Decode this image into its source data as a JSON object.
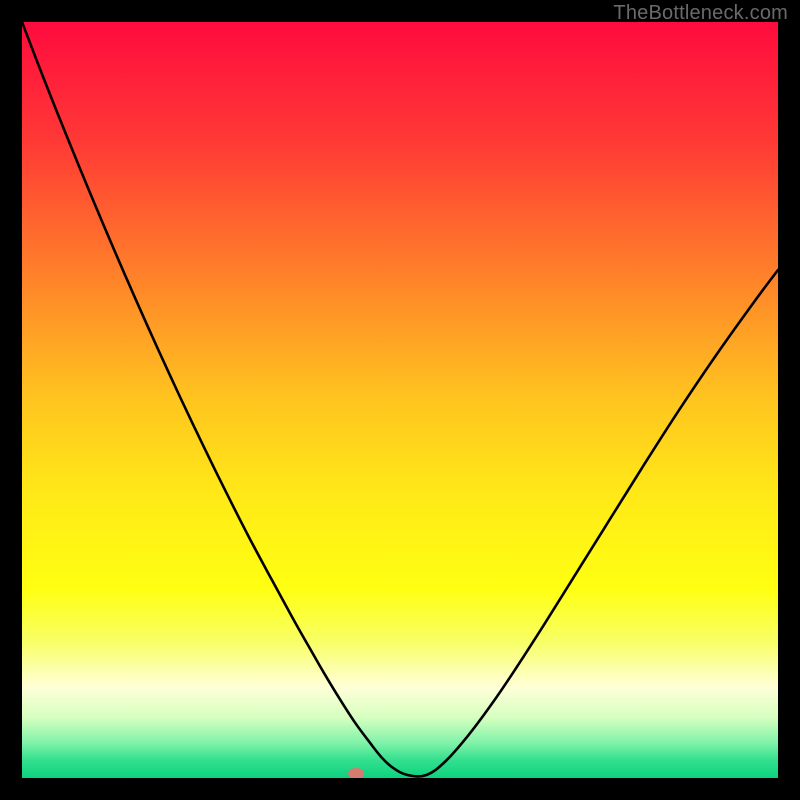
{
  "watermark": "TheBottleneck.com",
  "chart_data": {
    "type": "line",
    "title": "",
    "xlabel": "",
    "ylabel": "",
    "xlim": [
      0,
      100
    ],
    "ylim": [
      0,
      100
    ],
    "grid": false,
    "legend": false,
    "gradient_stops": [
      {
        "offset": 0.0,
        "color": "#ff0b3e"
      },
      {
        "offset": 0.16,
        "color": "#ff3a35"
      },
      {
        "offset": 0.33,
        "color": "#ff7f2a"
      },
      {
        "offset": 0.5,
        "color": "#ffc51f"
      },
      {
        "offset": 0.63,
        "color": "#ffea17"
      },
      {
        "offset": 0.75,
        "color": "#ffff12"
      },
      {
        "offset": 0.82,
        "color": "#f8ff66"
      },
      {
        "offset": 0.88,
        "color": "#ffffd8"
      },
      {
        "offset": 0.92,
        "color": "#d6ffc0"
      },
      {
        "offset": 0.955,
        "color": "#7cf2a8"
      },
      {
        "offset": 0.975,
        "color": "#36e08f"
      },
      {
        "offset": 1.0,
        "color": "#0cd37e"
      }
    ],
    "series": [
      {
        "name": "curve",
        "x": [
          0,
          3,
          6,
          9,
          12,
          15,
          18,
          21,
          24,
          27,
          30,
          33,
          36,
          38.5,
          40,
          42,
          44,
          46,
          47.5,
          49,
          51,
          53.5,
          56,
          59,
          62,
          65,
          69,
          73,
          77,
          82,
          87,
          92,
          97,
          100
        ],
        "y": [
          100,
          92.2,
          84.7,
          77.4,
          70.3,
          63.4,
          56.7,
          50.2,
          43.9,
          37.8,
          31.9,
          26.3,
          20.8,
          16.4,
          13.8,
          10.5,
          7.4,
          4.7,
          2.8,
          1.4,
          0.4,
          0.4,
          2.2,
          5.6,
          9.6,
          14.0,
          20.2,
          26.6,
          33.0,
          41.0,
          48.8,
          56.2,
          63.2,
          67.2
        ]
      }
    ],
    "marker": {
      "x": 44.2,
      "y": 0.6,
      "color": "#d67b70"
    }
  }
}
